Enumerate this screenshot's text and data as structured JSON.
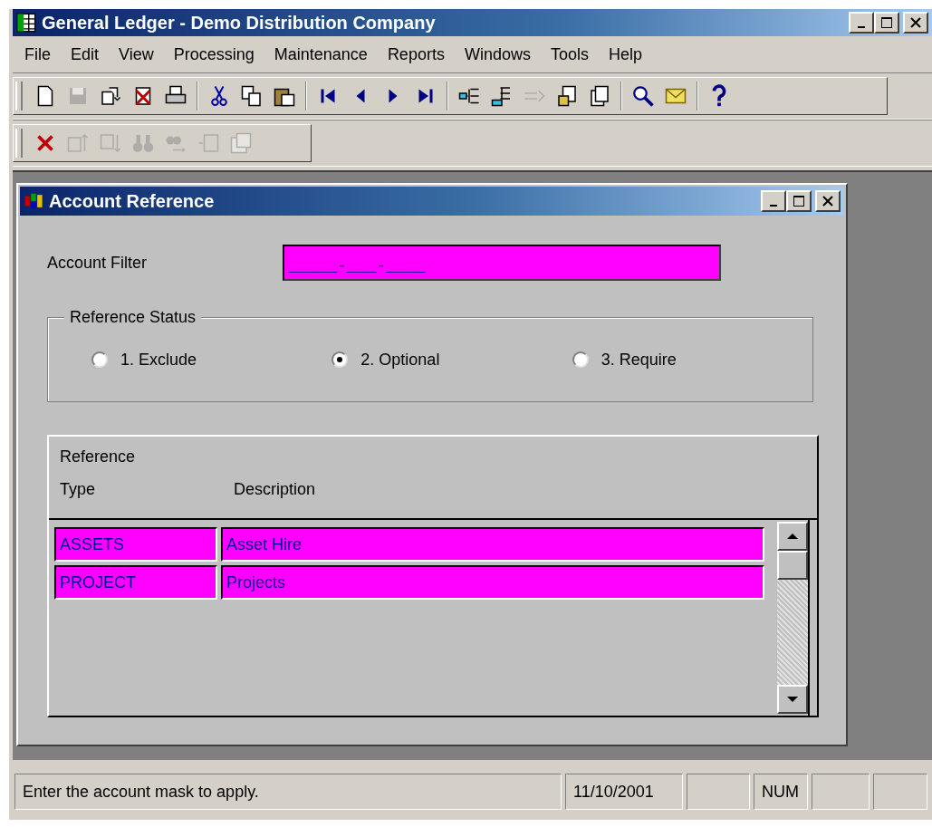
{
  "window": {
    "title": "General Ledger - Demo Distribution Company"
  },
  "menu": [
    "File",
    "Edit",
    "View",
    "Processing",
    "Maintenance",
    "Reports",
    "Windows",
    "Tools",
    "Help"
  ],
  "toolbar_main": [
    {
      "disabled": false
    },
    {
      "disabled": true
    },
    {
      "disabled": false
    },
    {
      "disabled": false
    },
    {
      "disabled": false
    },
    {
      "disabled": false
    },
    {
      "disabled": false
    },
    {
      "disabled": false
    },
    {
      "disabled": false
    },
    {
      "disabled": false
    },
    {
      "disabled": false
    },
    {
      "disabled": false
    },
    {
      "disabled": false
    },
    {
      "disabled": false
    },
    {
      "disabled": true
    },
    {
      "disabled": false
    },
    {
      "disabled": false
    },
    {
      "disabled": false
    },
    {
      "disabled": false
    },
    {
      "disabled": false
    }
  ],
  "toolbar_edit": [
    {
      "disabled": false
    },
    {
      "disabled": true
    },
    {
      "disabled": true
    },
    {
      "disabled": true
    },
    {
      "disabled": true
    },
    {
      "disabled": true
    },
    {
      "disabled": true
    }
  ],
  "child_window": {
    "title": "Account Reference",
    "account_filter": {
      "label": "Account Filter",
      "value": "_____-___-____"
    },
    "reference_status": {
      "legend": "Reference Status",
      "options": [
        {
          "label": "1. Exclude",
          "selected": false
        },
        {
          "label": "2. Optional",
          "selected": true
        },
        {
          "label": "3. Require",
          "selected": false
        }
      ]
    },
    "table": {
      "columns": [
        "Reference Type",
        "Description"
      ],
      "rows": [
        [
          "ASSETS",
          "Asset Hire"
        ],
        [
          "PROJECT",
          "Projects"
        ]
      ]
    }
  },
  "status_bar": {
    "message": "Enter the account mask to apply.",
    "date": "11/10/2001",
    "indicator": "NUM"
  }
}
